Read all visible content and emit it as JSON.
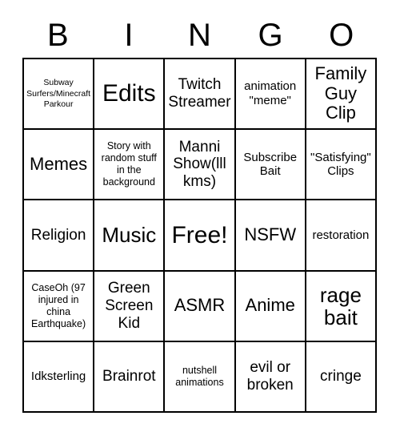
{
  "card": {
    "title": "BINGO",
    "header_letters": [
      "B",
      "I",
      "N",
      "G",
      "O"
    ],
    "colors": {
      "background": "#ffffff",
      "text": "#000000",
      "grid_line": "#000000"
    },
    "grid": {
      "columns": 5,
      "rows": 5,
      "free_space_label": "Free!",
      "free_space_position": "row3-col3"
    },
    "cells": [
      {
        "id": "r1c1",
        "label": "Subway Surfers/Minecraft Parkour",
        "size": "xxs"
      },
      {
        "id": "r1c2",
        "label": "Edits",
        "size": "xxl"
      },
      {
        "id": "r1c3",
        "label": "Twitch Streamer",
        "size": "md"
      },
      {
        "id": "r1c4",
        "label": "animation \"meme\"",
        "size": "sm"
      },
      {
        "id": "r1c5",
        "label": "Family Guy Clip",
        "size": "lg"
      },
      {
        "id": "r2c1",
        "label": "Memes",
        "size": "lg"
      },
      {
        "id": "r2c2",
        "label": "Story with random stuff in the background",
        "size": "xs"
      },
      {
        "id": "r2c3",
        "label": "Manni Show(lll kms)",
        "size": "md"
      },
      {
        "id": "r2c4",
        "label": "Subscribe Bait",
        "size": "sm"
      },
      {
        "id": "r2c5",
        "label": "\"Satisfying\" Clips",
        "size": "sm"
      },
      {
        "id": "r3c1",
        "label": "Religion",
        "size": "md"
      },
      {
        "id": "r3c2",
        "label": "Music",
        "size": "xl"
      },
      {
        "id": "r3c3",
        "label": "Free!",
        "size": "xxl"
      },
      {
        "id": "r3c4",
        "label": "NSFW",
        "size": "lg"
      },
      {
        "id": "r3c5",
        "label": "restoration",
        "size": "sm"
      },
      {
        "id": "r4c1",
        "label": "CaseOh (97 injured in china Earthquake)",
        "size": "xs"
      },
      {
        "id": "r4c2",
        "label": "Green Screen Kid",
        "size": "md"
      },
      {
        "id": "r4c3",
        "label": "ASMR",
        "size": "lg"
      },
      {
        "id": "r4c4",
        "label": "Anime",
        "size": "lg"
      },
      {
        "id": "r4c5",
        "label": "rage bait",
        "size": "xl"
      },
      {
        "id": "r5c1",
        "label": "Idksterling",
        "size": "sm"
      },
      {
        "id": "r5c2",
        "label": "Brainrot",
        "size": "md"
      },
      {
        "id": "r5c3",
        "label": "nutshell animations",
        "size": "xs"
      },
      {
        "id": "r5c4",
        "label": "evil or broken",
        "size": "md"
      },
      {
        "id": "r5c5",
        "label": "cringe",
        "size": "md"
      }
    ]
  }
}
